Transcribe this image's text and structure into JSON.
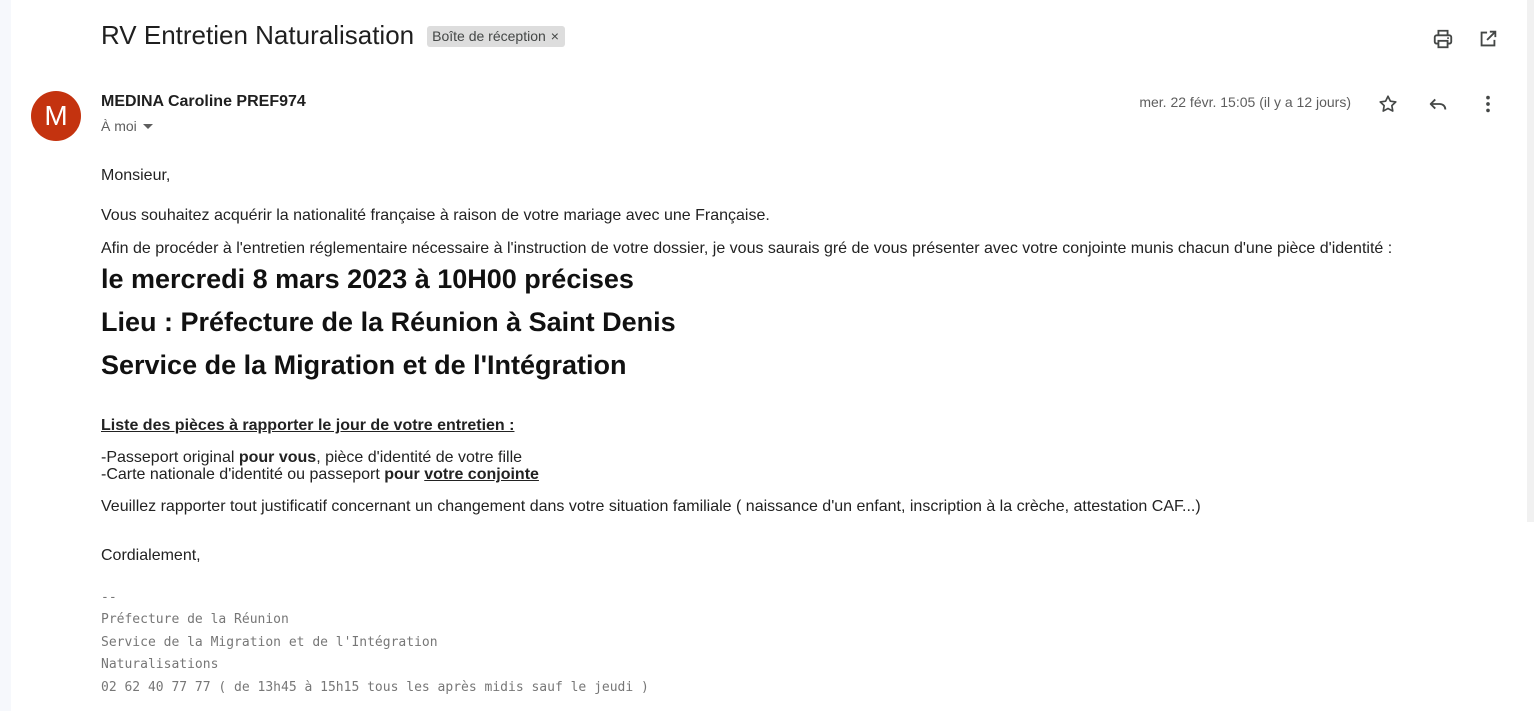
{
  "email": {
    "subject": "RV Entretien Naturalisation",
    "label_chip": "Boîte de réception",
    "chip_close": "×",
    "sender": {
      "initial": "M",
      "name": "MEDINA Caroline PREF974",
      "recipient": "À moi",
      "date": "mer. 22 févr. 15:05 (il y a 12 jours)",
      "avatar_color": "#c4330f"
    },
    "icons": {
      "print": "print-icon",
      "open_new": "open-in-new-window-icon",
      "star": "star-icon",
      "reply": "reply-icon",
      "more": "more-vert-icon"
    },
    "body": {
      "greeting": "Monsieur,",
      "para1": "Vous souhaitez acquérir la nationalité française à raison de votre mariage avec une Française.",
      "para2": "Afin de procéder à l'entretien réglementaire nécessaire à l'instruction de votre dossier, je   vous saurais gré de vous présenter avec votre conjointe munis chacun d'une pièce d'identité :",
      "headline1": "le mercredi 8 mars 2023 à 10H00 précises",
      "headline2": "Lieu : Préfecture de la Réunion à Saint Denis",
      "headline3": "Service de la Migration et de l'Intégration",
      "list_title": "Liste des pièces à rapporter le jour de votre entretien :",
      "item1": {
        "a": "-Passeport original ",
        "b": "pour vous",
        "c": ", pièce d'identité de votre fille"
      },
      "item2": {
        "a": "-Carte nationale d'identité ou passeport ",
        "b": "pour ",
        "c": "votre conjointe"
      },
      "para3": "Veuillez rapporter tout justificatif  concernant un changement dans votre situation familiale  ( naissance d'un enfant, inscription à la crèche, attestation CAF...)",
      "closing": "Cordialement,"
    },
    "signature": {
      "separator": "--",
      "line1": "Préfecture de la Réunion",
      "line2": "Service de la Migration et de l'Intégration",
      "line3": "Naturalisations",
      "line4": "02 62 40 77 77 ( de 13h45 à 15h15 tous les après midis sauf le jeudi )"
    }
  }
}
